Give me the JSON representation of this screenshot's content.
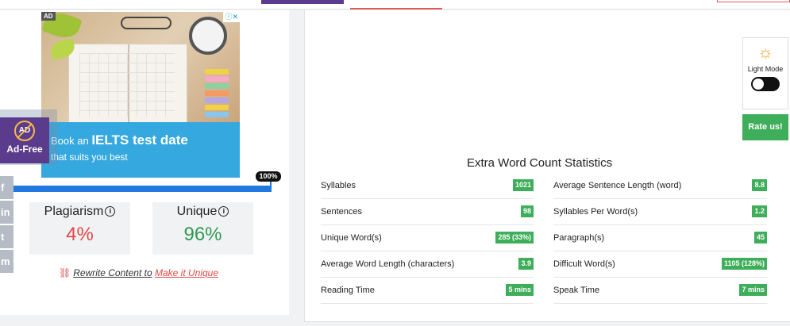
{
  "ad": {
    "label": "AD",
    "close": "ⓘ✕",
    "line1_prefix": "Book an",
    "line1_big": "IELTS test date",
    "line2": "that suits you best"
  },
  "adfree": {
    "icon_text": "AD",
    "label": "Ad-Free"
  },
  "social": [
    "f",
    "in",
    "t",
    "m"
  ],
  "progress": {
    "label": "100%",
    "value": 100
  },
  "plagiarism": {
    "title": "Plagiarism",
    "info": "i",
    "value": "4%"
  },
  "unique": {
    "title": "Unique",
    "info": "i",
    "value": "96%"
  },
  "rewrite": {
    "text": "Rewrite Content to",
    "link": "Make it Unique"
  },
  "theme": {
    "label": "Light Mode",
    "rate": "Rate us!"
  },
  "stats": {
    "title": "Extra Word Count Statistics",
    "left": [
      {
        "label": "Syllables",
        "value": "1021"
      },
      {
        "label": "Sentences",
        "value": "98"
      },
      {
        "label": "Unique Word(s)",
        "value": "285 (33%)"
      },
      {
        "label": "Average Word Length (characters)",
        "value": "3.9"
      },
      {
        "label": "Reading Time",
        "value": "5 mins"
      }
    ],
    "right": [
      {
        "label": "Average Sentence Length (word)",
        "value": "8.8"
      },
      {
        "label": "Syllables Per Word(s)",
        "value": "1.2"
      },
      {
        "label": "Paragraph(s)",
        "value": "45"
      },
      {
        "label": "Difficult Word(s)",
        "value": "1105 (128%)"
      },
      {
        "label": "Speak Time",
        "value": "7 mins"
      }
    ]
  },
  "colors": {
    "accent_purple": "#5b3b8c",
    "success": "#3fae5a",
    "danger": "#e04848",
    "progress": "#1e78e0"
  }
}
